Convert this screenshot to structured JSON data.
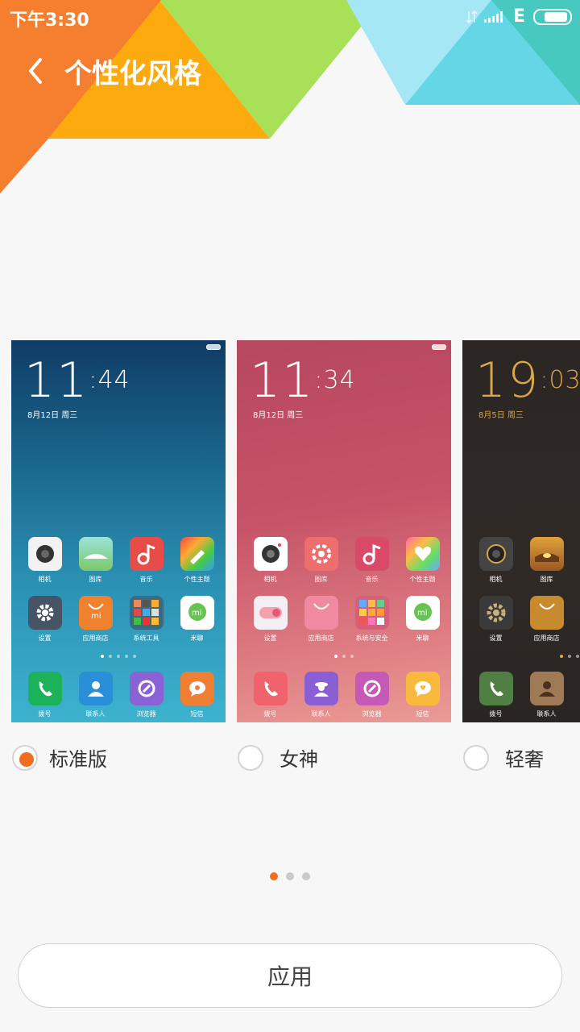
{
  "status_bar": {
    "time": "下午3:30",
    "network": "E"
  },
  "header": {
    "title": "个性化风格"
  },
  "themes": [
    {
      "name": "标准版",
      "selected": true,
      "clock_hour": "11",
      "clock_min": ":44",
      "date": "8月12日 周三",
      "apps_row1": [
        "相机",
        "图库",
        "音乐",
        "个性主题"
      ],
      "apps_row2": [
        "设置",
        "应用商店",
        "系统工具",
        "米聊"
      ],
      "dock": [
        "拨号",
        "联系人",
        "浏览器",
        "短信"
      ]
    },
    {
      "name": "女神",
      "selected": false,
      "clock_hour": "11",
      "clock_min": ":34",
      "date": "8月12日 周三",
      "apps_row1": [
        "相机",
        "图库",
        "音乐",
        "个性主题"
      ],
      "apps_row2": [
        "设置",
        "应用商店",
        "系统与安全",
        "米聊"
      ],
      "dock": [
        "拨号",
        "联系人",
        "浏览器",
        "短信"
      ]
    },
    {
      "name": "轻奢",
      "selected": false,
      "clock_hour": "19",
      "clock_min": ":03",
      "date": "8月5日 周三",
      "apps_row1": [
        "相机",
        "图库"
      ],
      "apps_row2": [
        "设置",
        "应用商店"
      ],
      "dock": [
        "拨号",
        "联系人"
      ]
    }
  ],
  "pager": {
    "current": 1,
    "total": 3
  },
  "actions": {
    "apply_label": "应用"
  },
  "colors": {
    "accent": "#f26d1f"
  }
}
